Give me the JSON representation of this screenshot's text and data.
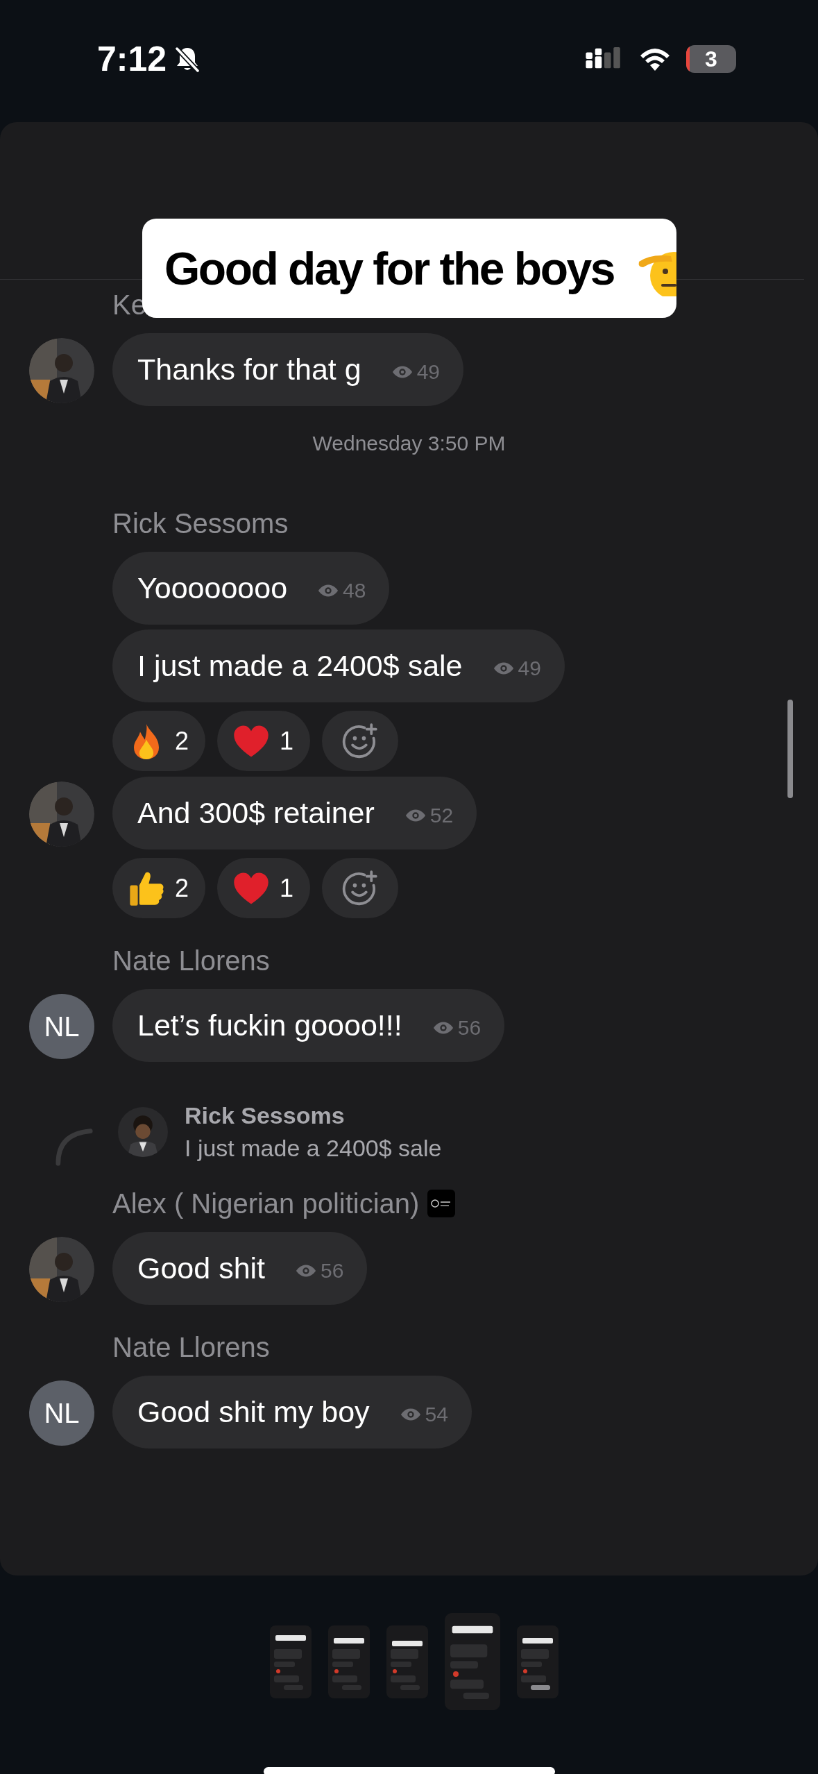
{
  "status_bar": {
    "time": "7:12",
    "muted": true,
    "battery": "3"
  },
  "caption": {
    "text": "Good day for the boys"
  },
  "chat": [
    {
      "kind": "sender",
      "name": "Ke"
    },
    {
      "kind": "message",
      "text": "Thanks for that g",
      "views": "49"
    },
    {
      "kind": "date",
      "text": "Wednesday 3:50 PM"
    },
    {
      "kind": "sender",
      "name": "Rick Sessoms"
    },
    {
      "kind": "message",
      "text": "Yoooooooo",
      "views": "48"
    },
    {
      "kind": "message",
      "text": "I just made a 2400$ sale",
      "views": "49"
    },
    {
      "kind": "reactions",
      "items": [
        {
          "kind": "fire",
          "count": "2"
        },
        {
          "kind": "heart",
          "count": "1"
        }
      ]
    },
    {
      "kind": "message",
      "text": "And 300$ retainer",
      "views": "52"
    },
    {
      "kind": "reactions",
      "items": [
        {
          "kind": "thumbs_up",
          "count": "2"
        },
        {
          "kind": "heart",
          "count": "1"
        }
      ]
    },
    {
      "kind": "sender",
      "name": "Nate Llorens"
    },
    {
      "kind": "message",
      "text": "Let’s fuckin goooo!!!",
      "views": "56",
      "avatar": {
        "kind": "initials",
        "initials": "NL"
      }
    },
    {
      "kind": "reply",
      "name": "Rick Sessoms",
      "text": "I just made a 2400$ sale"
    },
    {
      "kind": "sender",
      "name": "Alex ( Nigerian politician)",
      "badge": true
    },
    {
      "kind": "message",
      "text": "Good shit",
      "views": "56"
    },
    {
      "kind": "sender",
      "name": "Nate Llorens"
    },
    {
      "kind": "message",
      "text": "Good shit my boy",
      "views": "54",
      "avatar": {
        "kind": "initials",
        "initials": "NL"
      }
    }
  ],
  "thumbnails": [
    {
      "selected": false
    },
    {
      "selected": false
    },
    {
      "selected": false
    },
    {
      "selected": true
    },
    {
      "selected": false
    }
  ]
}
